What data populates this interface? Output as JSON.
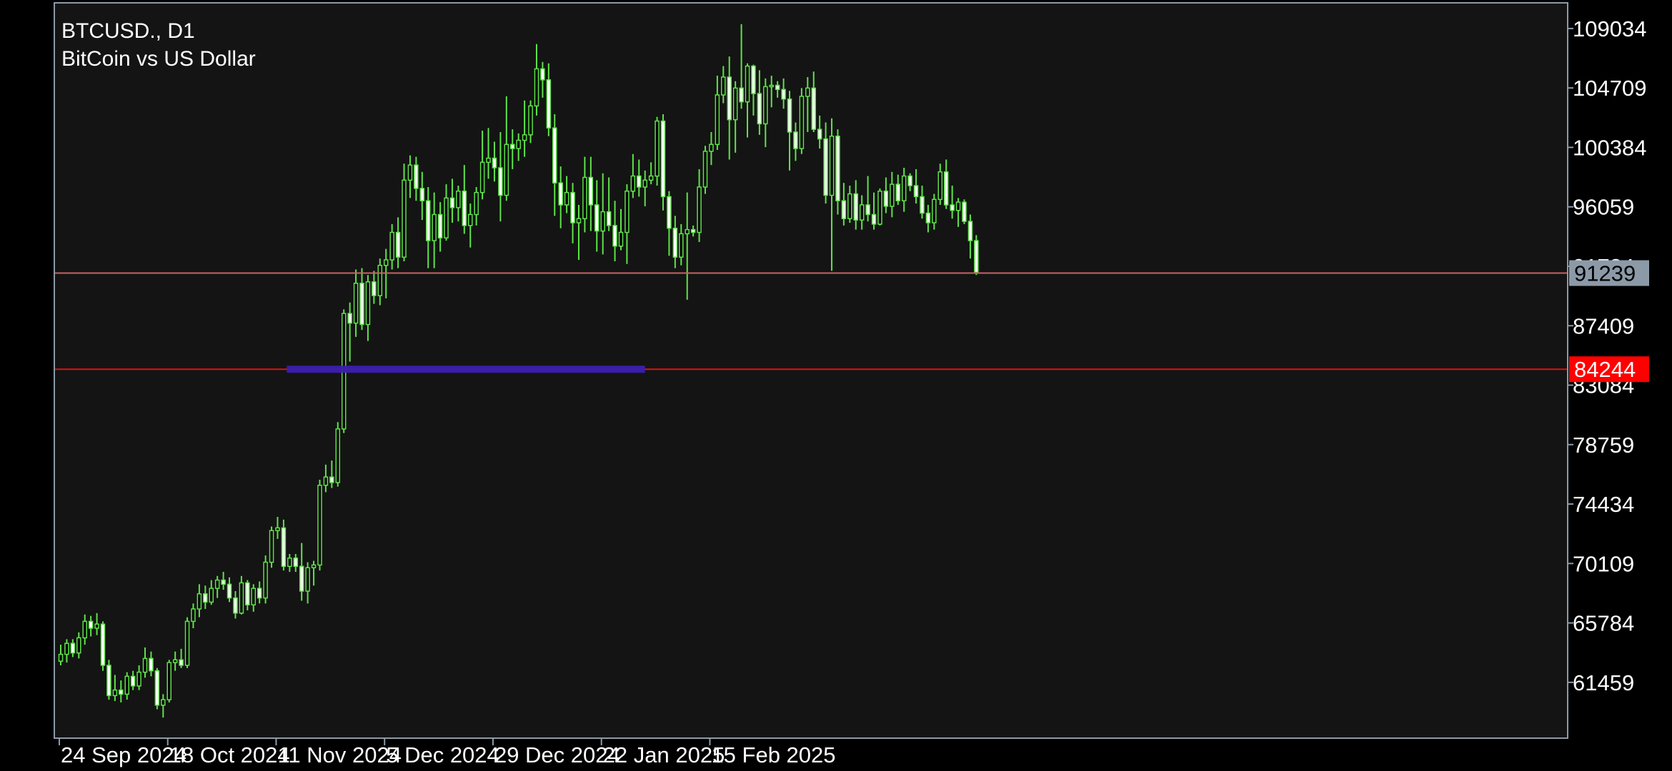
{
  "header": {
    "symbol_timeframe": "BTCUSD., D1",
    "description": "BitCoin vs US Dollar"
  },
  "colors": {
    "background": "#141414",
    "frame": "#8c9aa8",
    "candle": "#5fe34a",
    "bid_line": "#c86464",
    "level_line": "#e01010",
    "zone": "#3b1fb0",
    "bid_tag": "#8c9aa8",
    "level_tag": "#ff0000"
  },
  "chart_data": {
    "type": "candlestick",
    "ylim": [
      57400,
      110900
    ],
    "y_ticks": [
      109034,
      104709,
      100384,
      96059,
      91734,
      87409,
      83084,
      78759,
      74434,
      70109,
      65784,
      61459
    ],
    "x_tick_labels": [
      {
        "index": 0,
        "label": "24 Sep 2024"
      },
      {
        "index": 18,
        "label": "18 Oct 2024"
      },
      {
        "index": 36,
        "label": "11 Nov 2024"
      },
      {
        "index": 54,
        "label": "5 Dec 2024"
      },
      {
        "index": 72,
        "label": "29 Dec 2024"
      },
      {
        "index": 90,
        "label": "22 Jan 2025"
      },
      {
        "index": 108,
        "label": "15 Feb 2025"
      }
    ],
    "current_price": 91239,
    "level_price": 84244,
    "zone": {
      "from_index": 38,
      "to_index": 97,
      "price": 84244
    },
    "candles": [
      [
        63000,
        64200,
        62700,
        63500
      ],
      [
        63500,
        64600,
        62900,
        64300
      ],
      [
        64300,
        64600,
        63300,
        63600
      ],
      [
        63600,
        65100,
        63200,
        64700
      ],
      [
        64700,
        66400,
        64200,
        65900
      ],
      [
        65900,
        66300,
        64800,
        65400
      ],
      [
        65400,
        66500,
        64900,
        65700
      ],
      [
        65700,
        65900,
        62300,
        62700
      ],
      [
        62700,
        63100,
        60200,
        60500
      ],
      [
        60500,
        62000,
        60100,
        60900
      ],
      [
        60900,
        61600,
        60000,
        60600
      ],
      [
        60600,
        62200,
        60200,
        61900
      ],
      [
        61900,
        62300,
        60900,
        61200
      ],
      [
        61200,
        62700,
        60900,
        62200
      ],
      [
        62200,
        64000,
        61800,
        63200
      ],
      [
        63200,
        63700,
        61900,
        62300
      ],
      [
        62300,
        62500,
        59500,
        59800
      ],
      [
        59800,
        60600,
        58900,
        60200
      ],
      [
        60200,
        63100,
        60000,
        62900
      ],
      [
        62900,
        63700,
        62300,
        63100
      ],
      [
        63100,
        63900,
        62500,
        62700
      ],
      [
        62700,
        66200,
        62500,
        65900
      ],
      [
        65900,
        67200,
        65400,
        66800
      ],
      [
        66800,
        68600,
        66200,
        67900
      ],
      [
        67900,
        68500,
        66800,
        67300
      ],
      [
        67300,
        68900,
        67100,
        68300
      ],
      [
        68300,
        69200,
        67600,
        68900
      ],
      [
        68900,
        69500,
        68200,
        68600
      ],
      [
        68600,
        69100,
        67300,
        67600
      ],
      [
        67600,
        68100,
        66100,
        66500
      ],
      [
        66500,
        69200,
        66400,
        68700
      ],
      [
        68700,
        68900,
        66700,
        67100
      ],
      [
        67100,
        68600,
        66600,
        68300
      ],
      [
        68300,
        68800,
        67200,
        67600
      ],
      [
        67600,
        70700,
        67200,
        70200
      ],
      [
        70200,
        72800,
        69800,
        72500
      ],
      [
        72500,
        73500,
        71900,
        72700
      ],
      [
        72700,
        73300,
        69600,
        69900
      ],
      [
        69900,
        70800,
        69500,
        70500
      ],
      [
        70500,
        70800,
        69500,
        69900
      ],
      [
        69900,
        71600,
        67400,
        68100
      ],
      [
        68100,
        70200,
        67200,
        69800
      ],
      [
        69800,
        70300,
        68500,
        70000
      ],
      [
        70000,
        76200,
        69600,
        75800
      ],
      [
        75800,
        77300,
        75300,
        76400
      ],
      [
        76400,
        77600,
        75600,
        76000
      ],
      [
        76000,
        80400,
        75700,
        79900
      ],
      [
        79900,
        88600,
        79600,
        88300
      ],
      [
        88300,
        89100,
        84800,
        87600
      ],
      [
        87600,
        91500,
        86600,
        90500
      ],
      [
        90500,
        91600,
        87100,
        87500
      ],
      [
        87500,
        91100,
        86300,
        90600
      ],
      [
        90600,
        91400,
        89000,
        89600
      ],
      [
        89600,
        92300,
        88900,
        91800
      ],
      [
        91800,
        93000,
        89400,
        92200
      ],
      [
        92200,
        94800,
        91500,
        94200
      ],
      [
        94200,
        95300,
        91600,
        92400
      ],
      [
        92400,
        99200,
        92100,
        98000
      ],
      [
        98000,
        99800,
        96700,
        99100
      ],
      [
        99100,
        99700,
        96500,
        97400
      ],
      [
        97400,
        98600,
        95100,
        96500
      ],
      [
        96500,
        97500,
        91600,
        93600
      ],
      [
        93600,
        97100,
        91600,
        95500
      ],
      [
        95500,
        96400,
        92800,
        93800
      ],
      [
        93800,
        97700,
        93600,
        96700
      ],
      [
        96700,
        98100,
        94900,
        96000
      ],
      [
        96000,
        97600,
        95000,
        97200
      ],
      [
        97200,
        99100,
        94100,
        94700
      ],
      [
        94700,
        96300,
        93100,
        95500
      ],
      [
        95500,
        97500,
        94700,
        97100
      ],
      [
        97100,
        101600,
        96600,
        99300
      ],
      [
        99300,
        101800,
        98100,
        99600
      ],
      [
        99600,
        100800,
        97900,
        98900
      ],
      [
        98900,
        101500,
        95000,
        96900
      ],
      [
        96900,
        104100,
        96500,
        100600
      ],
      [
        100600,
        101700,
        98800,
        100300
      ],
      [
        100300,
        101400,
        99400,
        100900
      ],
      [
        100900,
        103800,
        99700,
        101300
      ],
      [
        101300,
        103800,
        100700,
        103400
      ],
      [
        103400,
        107900,
        102700,
        106100
      ],
      [
        106100,
        106600,
        104000,
        105300
      ],
      [
        105300,
        106500,
        101200,
        101800
      ],
      [
        101800,
        102800,
        95400,
        97800
      ],
      [
        97800,
        99000,
        94500,
        96200
      ],
      [
        96200,
        98300,
        95600,
        97100
      ],
      [
        97100,
        97800,
        93400,
        94900
      ],
      [
        94900,
        96200,
        92200,
        95200
      ],
      [
        95200,
        99700,
        94200,
        98200
      ],
      [
        98200,
        99700,
        94300,
        96200
      ],
      [
        96200,
        98000,
        92800,
        94300
      ],
      [
        94300,
        98500,
        92600,
        95700
      ],
      [
        95700,
        98200,
        94300,
        94700
      ],
      [
        94700,
        96500,
        92100,
        93200
      ],
      [
        93200,
        95900,
        92900,
        94200
      ],
      [
        94200,
        97700,
        91900,
        97200
      ],
      [
        97200,
        99900,
        96700,
        98300
      ],
      [
        98300,
        99500,
        96800,
        97500
      ],
      [
        97500,
        98700,
        96100,
        98000
      ],
      [
        98000,
        99300,
        97700,
        98300
      ],
      [
        98300,
        102600,
        97600,
        102300
      ],
      [
        102300,
        102800,
        95800,
        96800
      ],
      [
        96800,
        97200,
        92500,
        94500
      ],
      [
        94500,
        95400,
        91600,
        92400
      ],
      [
        92400,
        94800,
        91800,
        94100
      ],
      [
        94100,
        97100,
        89300,
        94400
      ],
      [
        94400,
        94700,
        93900,
        94200
      ],
      [
        94200,
        98800,
        93500,
        97500
      ],
      [
        97500,
        100500,
        97000,
        100100
      ],
      [
        100100,
        101500,
        99100,
        100600
      ],
      [
        100600,
        105600,
        100200,
        104200
      ],
      [
        104200,
        106300,
        103600,
        105500
      ],
      [
        105500,
        107000,
        99500,
        102400
      ],
      [
        102400,
        105200,
        100000,
        104700
      ],
      [
        104700,
        109350,
        103200,
        103700
      ],
      [
        103700,
        106500,
        101100,
        106300
      ],
      [
        106300,
        106400,
        102700,
        104300
      ],
      [
        104300,
        106000,
        101300,
        102100
      ],
      [
        102100,
        105400,
        100400,
        104800
      ],
      [
        104800,
        105600,
        103300,
        104900
      ],
      [
        104900,
        105200,
        104000,
        104600
      ],
      [
        104600,
        105400,
        103200,
        103900
      ],
      [
        103900,
        104500,
        98700,
        101500
      ],
      [
        101500,
        102200,
        99400,
        100300
      ],
      [
        100300,
        104700,
        99900,
        104100
      ],
      [
        104100,
        105500,
        101500,
        104700
      ],
      [
        104700,
        105900,
        101500,
        101700
      ],
      [
        101700,
        102700,
        100300,
        101000
      ],
      [
        101000,
        102200,
        96300,
        96900
      ],
      [
        96900,
        102500,
        91400,
        101200
      ],
      [
        101200,
        101700,
        95500,
        96500
      ],
      [
        96500,
        97800,
        94700,
        95200
      ],
      [
        95200,
        97600,
        94900,
        97000
      ],
      [
        97000,
        98000,
        94400,
        95100
      ],
      [
        95100,
        96900,
        94400,
        96200
      ],
      [
        96200,
        98300,
        95000,
        95500
      ],
      [
        95500,
        97100,
        94400,
        94800
      ],
      [
        94800,
        97400,
        94700,
        97200
      ],
      [
        97200,
        98200,
        95600,
        96100
      ],
      [
        96100,
        98600,
        95300,
        97700
      ],
      [
        97700,
        98400,
        96200,
        96500
      ],
      [
        96500,
        98900,
        95700,
        98300
      ],
      [
        98300,
        98500,
        97200,
        97600
      ],
      [
        97600,
        98800,
        96300,
        96800
      ],
      [
        96800,
        97600,
        95200,
        95600
      ],
      [
        95600,
        96200,
        94200,
        94900
      ],
      [
        94900,
        97000,
        94400,
        96600
      ],
      [
        96600,
        99200,
        96200,
        98600
      ],
      [
        98600,
        99500,
        95900,
        96200
      ],
      [
        96200,
        97600,
        95200,
        95800
      ],
      [
        95800,
        96700,
        94600,
        96400
      ],
      [
        96400,
        96600,
        94800,
        95000
      ],
      [
        95000,
        95500,
        92300,
        93600
      ],
      [
        93600,
        94000,
        91100,
        91300
      ]
    ]
  }
}
